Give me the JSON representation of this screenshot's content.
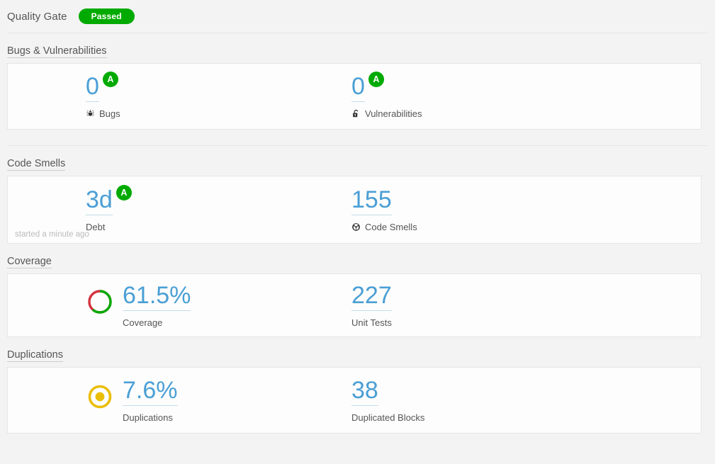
{
  "quality_gate": {
    "label": "Quality Gate",
    "status": "Passed",
    "status_color": "#00aa00"
  },
  "colors": {
    "value_blue": "#4b9fd5",
    "rating_green": "#00aa00",
    "coverage_green": "#00aa00",
    "coverage_red": "#d4333f",
    "duplication_amber": "#eabe06",
    "page_background": "#f3f3f3",
    "card_background": "#fdfdfd"
  },
  "sections": [
    {
      "title": "Bugs & Vulnerabilities",
      "measures": [
        {
          "value": "0",
          "label": "Bugs",
          "rating": "A",
          "icon": "bug-icon"
        },
        {
          "value": "0",
          "label": "Vulnerabilities",
          "rating": "A",
          "icon": "open-lock-icon"
        }
      ]
    },
    {
      "title": "Code Smells",
      "footnote": "started a minute ago",
      "measures": [
        {
          "value": "3d",
          "label": "Debt",
          "rating": "A",
          "icon": ""
        },
        {
          "value": "155",
          "label": "Code Smells",
          "rating": "",
          "icon": "code-smell-icon"
        }
      ]
    },
    {
      "title": "Coverage",
      "measures": [
        {
          "value": "61.5%",
          "label": "Coverage",
          "rating": "",
          "icon": "",
          "donut": "coverage-donut",
          "donut_percent": 61.5
        },
        {
          "value": "227",
          "label": "Unit Tests",
          "rating": "",
          "icon": ""
        }
      ]
    },
    {
      "title": "Duplications",
      "measures": [
        {
          "value": "7.6%",
          "label": "Duplications",
          "rating": "",
          "icon": "",
          "donut": "duplications-indicator",
          "donut_percent": 7.6
        },
        {
          "value": "38",
          "label": "Duplicated Blocks",
          "rating": "",
          "icon": ""
        }
      ]
    }
  ]
}
